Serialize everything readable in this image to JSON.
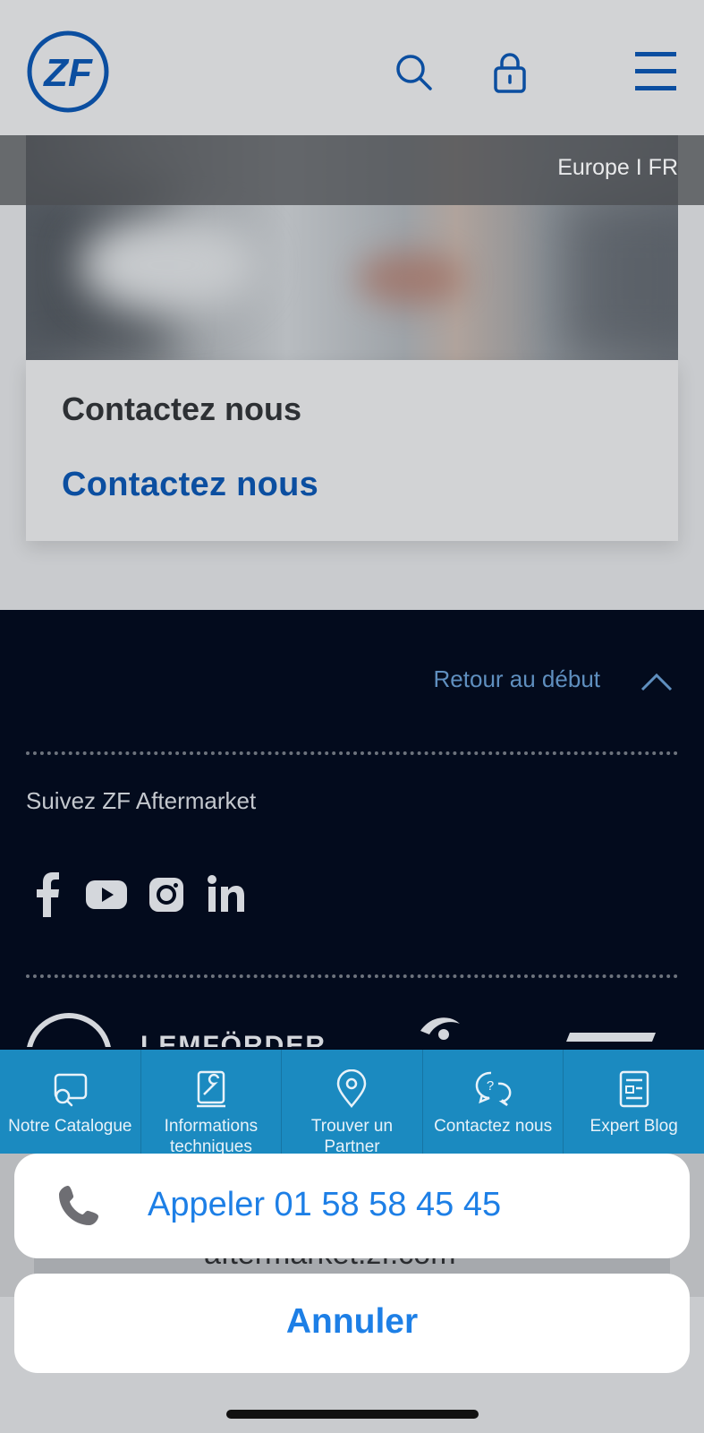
{
  "header": {
    "logo_text": "ZF"
  },
  "hero": {
    "region": "Europe I FR"
  },
  "card": {
    "title": "Contactez nous",
    "link": "Contactez nous"
  },
  "footer": {
    "back_to_top": "Retour au début",
    "follow": "Suivez ZF Aftermarket",
    "social": [
      "facebook-icon",
      "youtube-icon",
      "instagram-icon",
      "linkedin-icon"
    ],
    "brands": [
      "ZF",
      "LEMFÖRDER",
      "SACHS",
      "TRW"
    ]
  },
  "quicknav": [
    {
      "icon": "catalog-icon",
      "label": "Notre Catalogue"
    },
    {
      "icon": "technical-info-icon",
      "label": "Informations techniques"
    },
    {
      "icon": "location-pin-icon",
      "label": "Trouver un Partner"
    },
    {
      "icon": "contact-chat-icon",
      "label": "Contactez nous"
    },
    {
      "icon": "blog-icon",
      "label": "Expert Blog"
    }
  ],
  "browser": {
    "url": "aftermarket.zf.com"
  },
  "action_sheet": {
    "call_label": "Appeler 01 58 58 45 45",
    "cancel_label": "Annuler"
  },
  "colors": {
    "zf_blue": "#0b4ea0",
    "ios_blue": "#1d7fe6",
    "footer_bg": "#030b1d",
    "quicknav_bg": "#1b8ac0"
  }
}
